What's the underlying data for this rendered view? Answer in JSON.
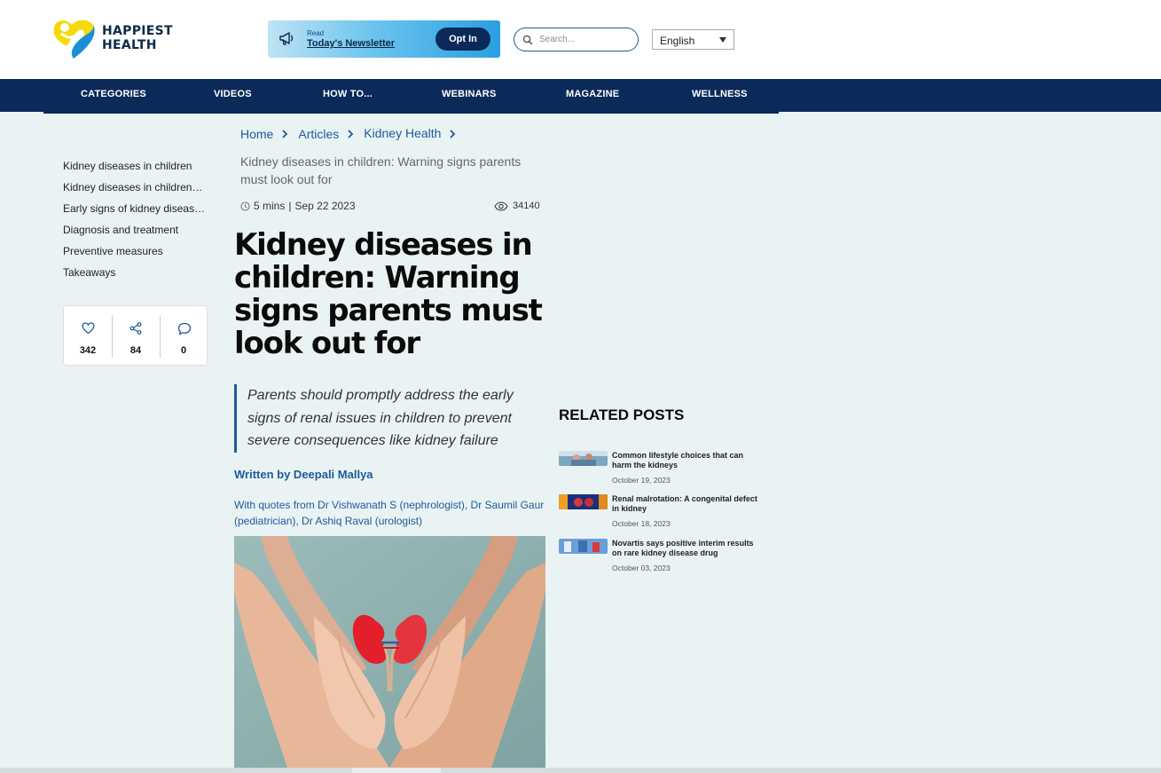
{
  "brand": {
    "name_line1": "HAPPIEST",
    "name_line2": "HEALTH"
  },
  "newsletter": {
    "read_label": "Read",
    "title": "Today's Newsletter",
    "button": "Opt In"
  },
  "search": {
    "placeholder": "Search..."
  },
  "language": {
    "selected": "English"
  },
  "nav": [
    "CATEGORIES",
    "VIDEOS",
    "HOW TO...",
    "WEBINARS",
    "MAGAZINE",
    "WELLNESS"
  ],
  "toc": [
    "Kidney diseases in children",
    "Kidney diseases in children…",
    "Early signs of kidney diseas…",
    "Diagnosis and treatment",
    "Preventive measures",
    "Takeaways"
  ],
  "stats": {
    "likes": "342",
    "shares": "84",
    "comments": "0"
  },
  "breadcrumb": {
    "home": "Home",
    "articles": "Articles",
    "category": "Kidney Health"
  },
  "article": {
    "crumb_title": "Kidney diseases in children: Warning signs parents must look out for",
    "read_time": "5 mins",
    "separator": "|",
    "date": "Sep 22 2023",
    "views": "34140",
    "headline": "Kidney diseases in children: Warning signs parents must look out for",
    "blurb": "Parents should promptly address the early signs of renal issues in children to prevent severe consequences like kidney failure",
    "author": "Written by Deepali Mallya",
    "quotes": "With quotes from Dr Vishwanath S (nephrologist), Dr Saumil Gaur (pediatrician), Dr Ashiq Raval (urologist)"
  },
  "related": {
    "title": "RELATED POSTS",
    "posts": [
      {
        "title": "Common lifestyle choices that can harm the kidneys",
        "date": "October 19, 2023"
      },
      {
        "title": "Renal malrotation: A congenital defect in kidney",
        "date": "October 18, 2023"
      },
      {
        "title": "Novartis says positive interim results on rare kidney disease drug",
        "date": "October 03, 2023"
      }
    ]
  },
  "colors": {
    "navy": "#0b2a5a",
    "link_blue": "#1c5a9a",
    "page_bg": "#eaf3f3"
  }
}
